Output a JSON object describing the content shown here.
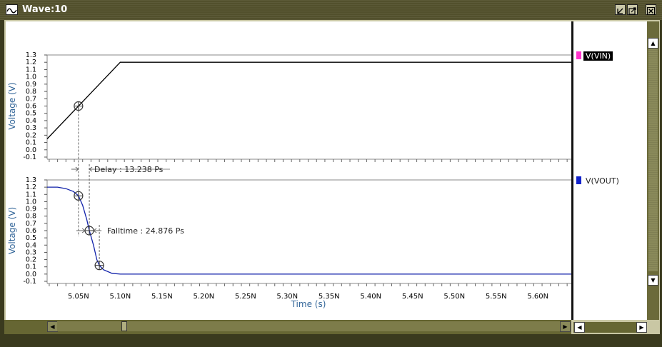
{
  "window": {
    "title": "Wave:10"
  },
  "legend": {
    "items": [
      {
        "label": "V(VIN)",
        "color": "#ff33cc",
        "selected": true
      },
      {
        "label": "V(VOUT)",
        "color": "#1122cc",
        "selected": false
      }
    ]
  },
  "measurements": {
    "delay": "Delay : 13.238 Ps",
    "falltime": "Falltime : 24.876 Ps"
  },
  "chart_data": [
    {
      "type": "line",
      "series": [
        {
          "name": "V(VIN)",
          "color": "#000000",
          "points": [
            [
              5.0125,
              0.15
            ],
            [
              5.1,
              1.2
            ],
            [
              5.64,
              1.2
            ]
          ]
        }
      ],
      "markers": [
        [
          5.05,
          0.6
        ]
      ],
      "ylabel": "Voltage (V)",
      "ylim": [
        -0.1,
        1.3
      ],
      "yticks": [
        "1.3",
        "1.2",
        "1.1",
        "1.0",
        "0.9",
        "0.8",
        "0.7",
        "0.6",
        "0.5",
        "0.4",
        "0.3",
        "0.2",
        "0.1",
        "0.0",
        "-0.1"
      ],
      "xlim": [
        5.0125,
        5.64
      ]
    },
    {
      "type": "line",
      "series": [
        {
          "name": "V(VOUT)",
          "color": "#1122aa",
          "points": [
            [
              5.0125,
              1.2
            ],
            [
              5.025,
              1.2
            ],
            [
              5.035,
              1.18
            ],
            [
              5.044,
              1.14
            ],
            [
              5.05,
              1.08
            ],
            [
              5.055,
              0.95
            ],
            [
              5.06,
              0.75
            ],
            [
              5.063,
              0.6
            ],
            [
              5.068,
              0.4
            ],
            [
              5.072,
              0.2
            ],
            [
              5.075,
              0.12
            ],
            [
              5.08,
              0.06
            ],
            [
              5.09,
              0.01
            ],
            [
              5.1,
              0.0
            ],
            [
              5.64,
              0.0
            ]
          ]
        }
      ],
      "markers": [
        [
          5.05,
          1.08
        ],
        [
          5.063,
          0.6
        ],
        [
          5.075,
          0.12
        ]
      ],
      "ylabel": "Voltage (V)",
      "xlabel": "Time (s)",
      "ylim": [
        -0.1,
        1.3
      ],
      "yticks": [
        "1.3",
        "1.2",
        "1.1",
        "1.0",
        "0.9",
        "0.8",
        "0.7",
        "0.6",
        "0.5",
        "0.4",
        "0.3",
        "0.2",
        "0.1",
        "0.0",
        "-0.1"
      ],
      "xlim": [
        5.0125,
        5.64
      ],
      "xticks": [
        "5.05N",
        "5.10N",
        "5.15N",
        "5.20N",
        "5.25N",
        "5.30N",
        "5.35N",
        "5.40N",
        "5.45N",
        "5.50N",
        "5.55N",
        "5.60N"
      ]
    }
  ]
}
